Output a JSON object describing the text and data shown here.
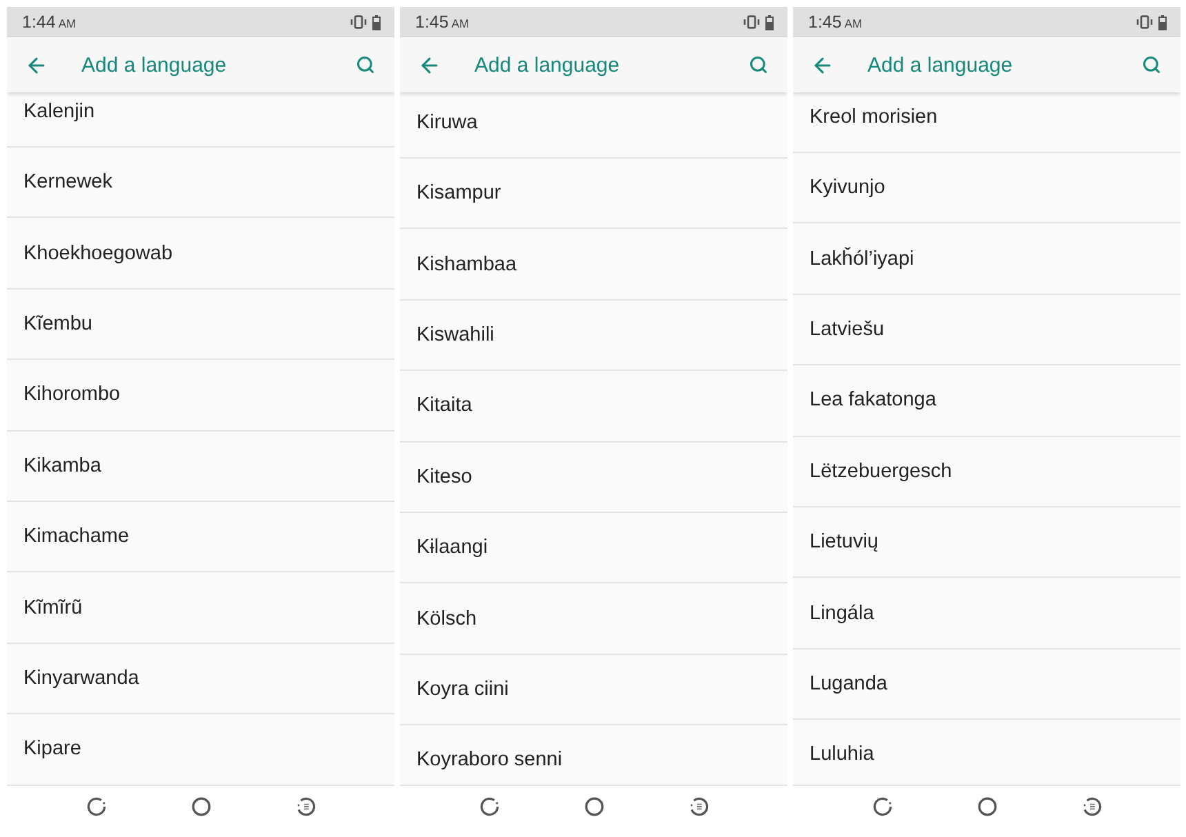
{
  "screens": [
    {
      "status_bar": {
        "time": "1:44",
        "meridiem": "AM"
      },
      "toolbar": {
        "title": "Add a language"
      },
      "languages": [
        "Kalenjin",
        "Kernewek",
        "Khoekhoegowab",
        "Kĩembu",
        "Kihorombo",
        "Kikamba",
        "Kimachame",
        "Kĩmĩrũ",
        "Kinyarwanda",
        "Kipare"
      ]
    },
    {
      "status_bar": {
        "time": "1:45",
        "meridiem": "AM"
      },
      "toolbar": {
        "title": "Add a language"
      },
      "languages": [
        "Kiruwa",
        "Kisampur",
        "Kishambaa",
        "Kiswahili",
        "Kitaita",
        "Kiteso",
        "Kɨlaangi",
        "Kölsch",
        "Koyra ciini",
        "Koyraboro senni"
      ]
    },
    {
      "status_bar": {
        "time": "1:45",
        "meridiem": "AM"
      },
      "toolbar": {
        "title": "Add a language"
      },
      "languages": [
        "Kreol morisien",
        "Kyivunjo",
        "Lakȟól’iyapi",
        "Latviešu",
        "Lea fakatonga",
        "Lëtzebuergesch",
        "Lietuvių",
        "Lingála",
        "Luganda",
        "Luluhia"
      ]
    }
  ]
}
